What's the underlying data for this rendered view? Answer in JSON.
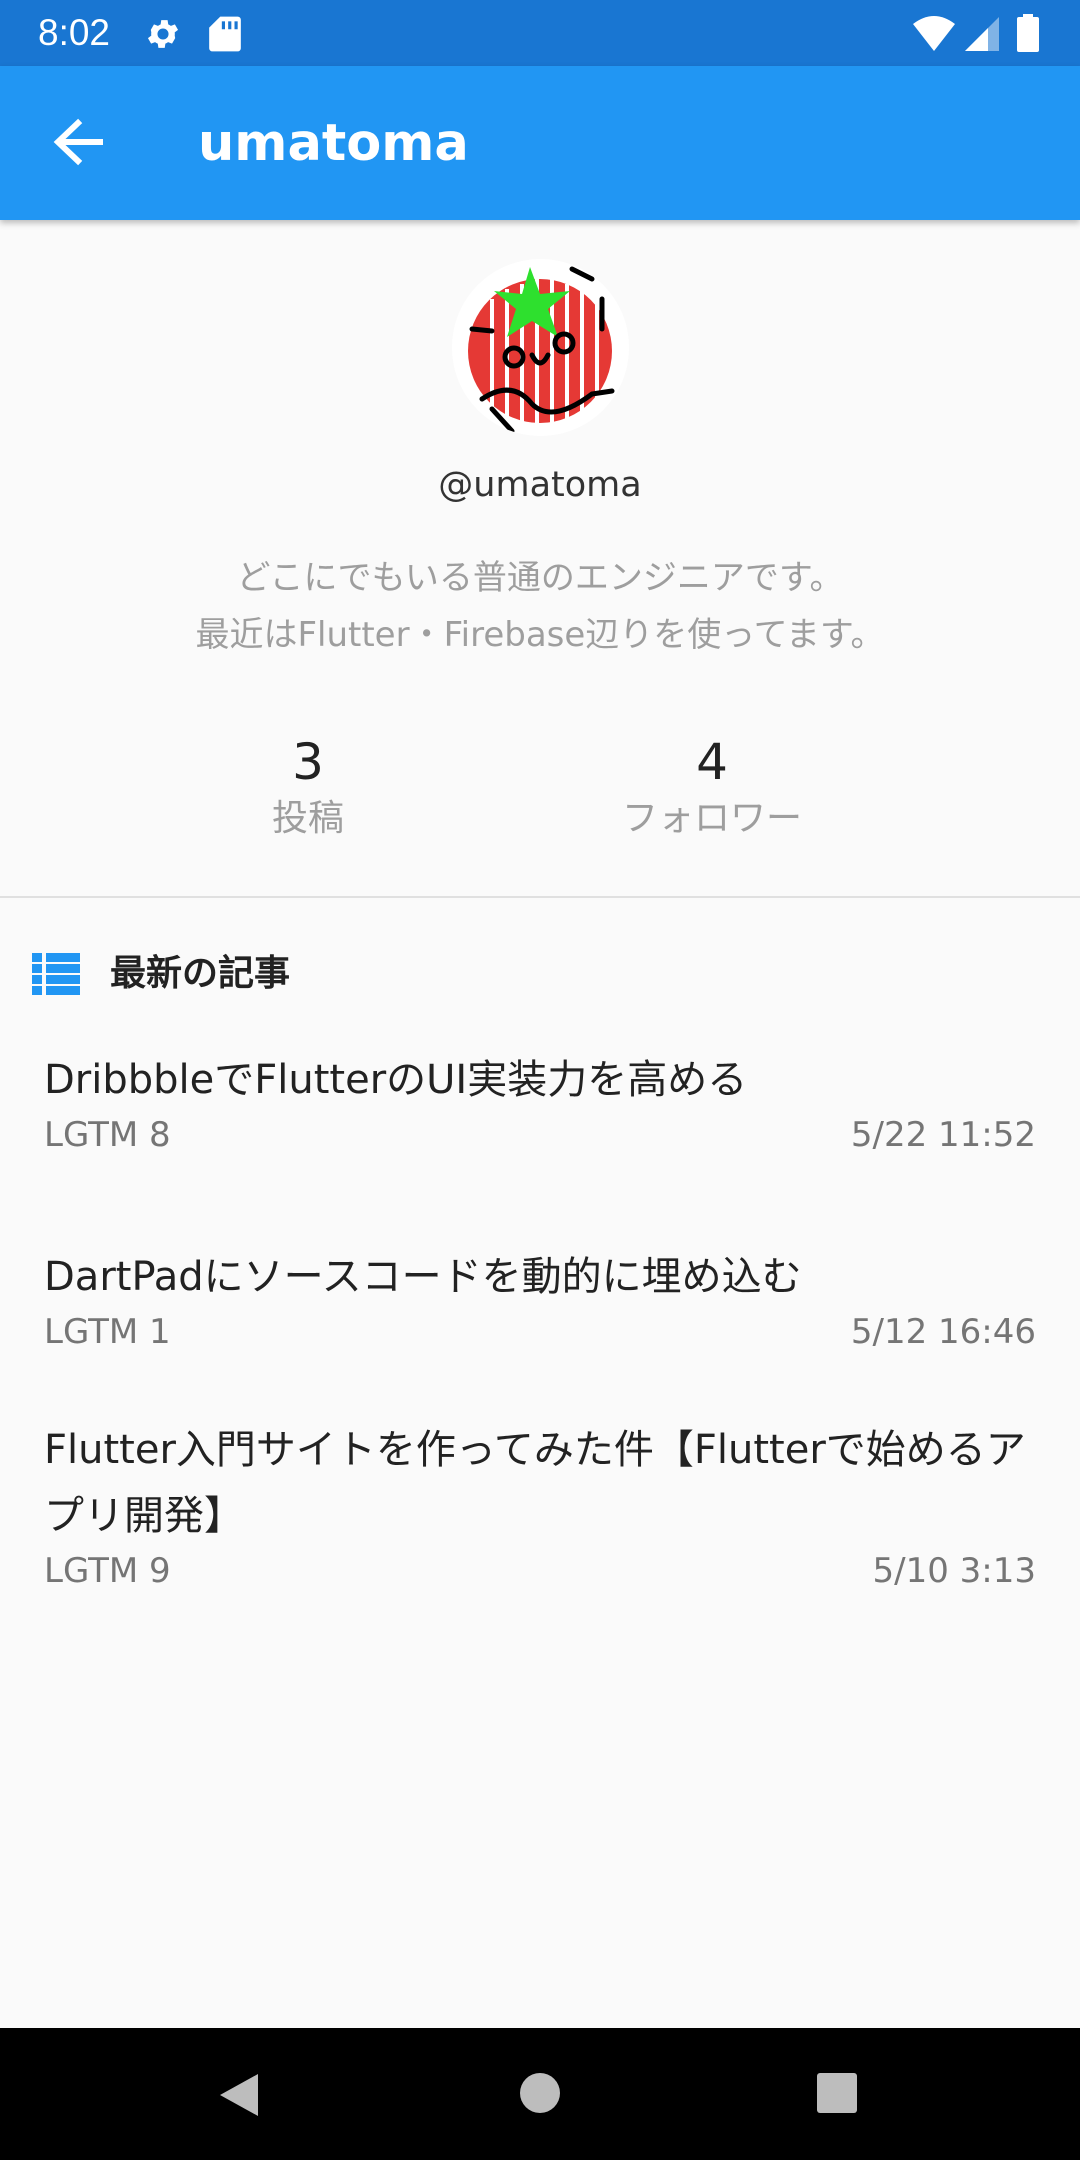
{
  "status_bar": {
    "time": "8:02",
    "left_icons": [
      "settings-icon",
      "sd-card-icon"
    ],
    "right_icons": [
      "wifi-icon",
      "cell-signal-icon",
      "battery-icon"
    ]
  },
  "app_bar": {
    "back_icon": "arrow-back-icon",
    "title": "umatoma",
    "color": "#2196F3"
  },
  "profile": {
    "avatar": "tomato-drawing-avatar",
    "handle": "@umatoma",
    "bio_line1": "どこにでもいる普通のエンジニアです。",
    "bio_line2": "最近はFlutter・Firebase辺りを使ってます。",
    "stats": {
      "posts": {
        "value": "3",
        "label": "投稿"
      },
      "followers": {
        "value": "4",
        "label": "フォロワー"
      }
    }
  },
  "section": {
    "icon": "list-icon",
    "title": "最新の記事"
  },
  "articles": [
    {
      "title": "DribbbleでFlutterのUI実装力を高める",
      "lgtm": "LGTM 8",
      "date": "5/22 11:52"
    },
    {
      "title": "DartPadにソースコードを動的に埋め込む",
      "lgtm": "LGTM 1",
      "date": "5/12 16:46"
    },
    {
      "title": "Flutter入門サイトを作ってみた件【Flutterで始めるアプリ開発】",
      "lgtm": "LGTM 9",
      "date": "5/10 3:13"
    }
  ],
  "nav_bar": {
    "icons": [
      "back-triangle-icon",
      "home-circle-icon",
      "recents-square-icon"
    ]
  }
}
